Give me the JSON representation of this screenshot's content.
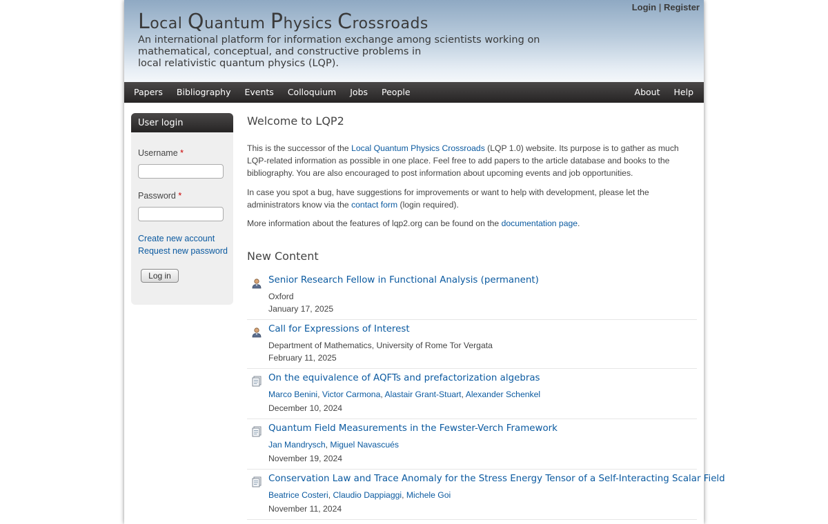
{
  "header": {
    "title_first": "L",
    "title_rest1": "ocal ",
    "title_q": "Q",
    "title_rest2": "uantum ",
    "title_p": "P",
    "title_rest3": "hysics ",
    "title_c": "C",
    "title_rest4": "rossroads",
    "slogan_lines": [
      "An international platform for information exchange among scientists working on",
      "mathematical, conceptual, and constructive problems in",
      "local relativistic quantum physics (LQP)."
    ],
    "login_link": "Login",
    "separator": "|",
    "register_link": "Register"
  },
  "nav": {
    "left": [
      "Papers",
      "Bibliography",
      "Events",
      "Colloquium",
      "Jobs",
      "People"
    ],
    "right": [
      "About",
      "Help"
    ]
  },
  "login_block": {
    "title": "User login",
    "username_label": "Username",
    "password_label": "Password",
    "required_mark": "*",
    "username_value": "",
    "password_value": "",
    "create_account": "Create new account",
    "request_password": "Request new password",
    "login_button": "Log in"
  },
  "main": {
    "welcome_title": "Welcome to LQP2",
    "p1_a": "This is the successor of the ",
    "p1_link": "Local Quantum Physics Crossroads",
    "p1_b": " (LQP 1.0) website. Its purpose is to gather as much LQP-related information as possible in one place. Feel free to add papers to the article database and books to the bibliography. You are also encouraged to post information about upcoming events and job opportunities.",
    "p2_a": "In case you spot a bug, have suggestions for improvements or want to help with development, please let the administrators know via the ",
    "p2_link": "contact form",
    "p2_b": " (login required).",
    "p3_a": "More information about the features of lqp2.org can be found on the ",
    "p3_link": "documentation page",
    "p3_b": ".",
    "new_content_title": "New Content",
    "items": [
      {
        "icon": "person-icon",
        "title": "Senior Research Fellow in Functional Analysis (permanent)",
        "meta": "Oxford",
        "date": "January 17, 2025"
      },
      {
        "icon": "person-icon",
        "title": "Call for Expressions of Interest",
        "meta": "Department of Mathematics, University of Rome Tor Vergata",
        "date": "February 11, 2025"
      },
      {
        "icon": "document-icon",
        "title": "On the equivalence of AQFTs and prefactorization algebras",
        "authors": [
          "Marco Benini",
          "Victor Carmona",
          "Alastair Grant-Stuart",
          "Alexander Schenkel"
        ],
        "date": "December 10, 2024"
      },
      {
        "icon": "document-icon",
        "title": "Quantum Field Measurements in the Fewster-Verch Framework",
        "authors": [
          "Jan Mandrysch",
          "Miguel Navascués"
        ],
        "date": "November 19, 2024"
      },
      {
        "icon": "document-icon",
        "title": "Conservation Law and Trace Anomaly for the Stress Energy Tensor of a Self-Interacting Scalar Field",
        "authors": [
          "Beatrice Costeri",
          "Claudio Dappiaggi",
          "Michele Goi"
        ],
        "date": "November 11, 2024"
      }
    ]
  },
  "colors": {
    "link": "#0b5aa0",
    "nav_bg": "#2f2d2d",
    "header_top": "#8fa9c3",
    "required": "#cc0000"
  }
}
